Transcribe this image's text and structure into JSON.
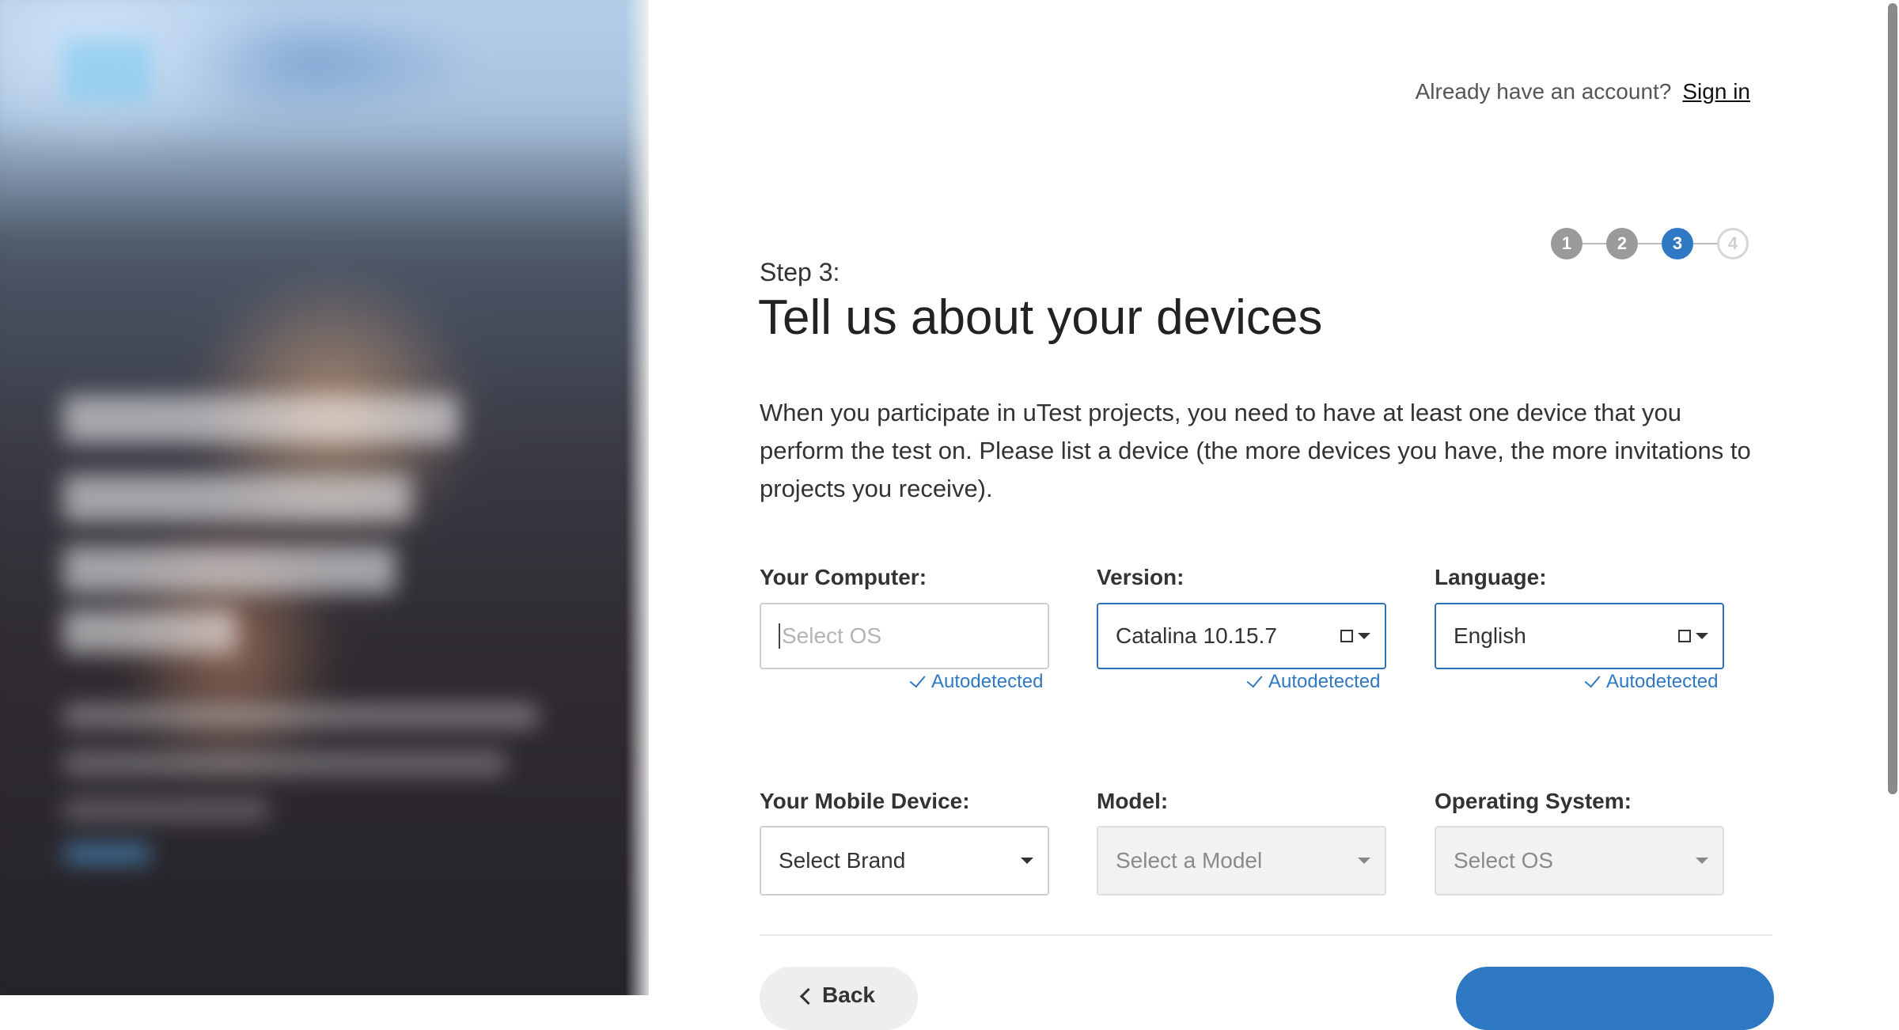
{
  "header": {
    "account_prompt": "Already have an account?",
    "sign_in_link": "Sign in"
  },
  "steps": {
    "items": [
      "1",
      "2",
      "3",
      "4"
    ],
    "current": 3
  },
  "page": {
    "step_label": "Step 3:",
    "title": "Tell us about your devices",
    "intro": "When you participate in uTest projects, you need to have at least one device that you perform the test on. Please list a device (the more devices you have, the more invitations to projects you receive)."
  },
  "computer": {
    "os_label": "Your Computer:",
    "os_placeholder": "Select OS",
    "os_autodetected": "Autodetected",
    "version_label": "Version:",
    "version_value": "Catalina 10.15.7",
    "version_autodetected": "Autodetected",
    "language_label": "Language:",
    "language_value": "English",
    "language_autodetected": "Autodetected"
  },
  "mobile": {
    "brand_label": "Your Mobile Device:",
    "brand_value": "Select Brand",
    "model_label": "Model:",
    "model_value": "Select a Model",
    "os_label": "Operating System:",
    "os_value": "Select OS"
  },
  "footer": {
    "back_label": "Back",
    "next_label": ""
  },
  "colors": {
    "accent": "#2f78c4",
    "step_done": "#9a9a9a",
    "focus_border": "#2f6fb6"
  }
}
